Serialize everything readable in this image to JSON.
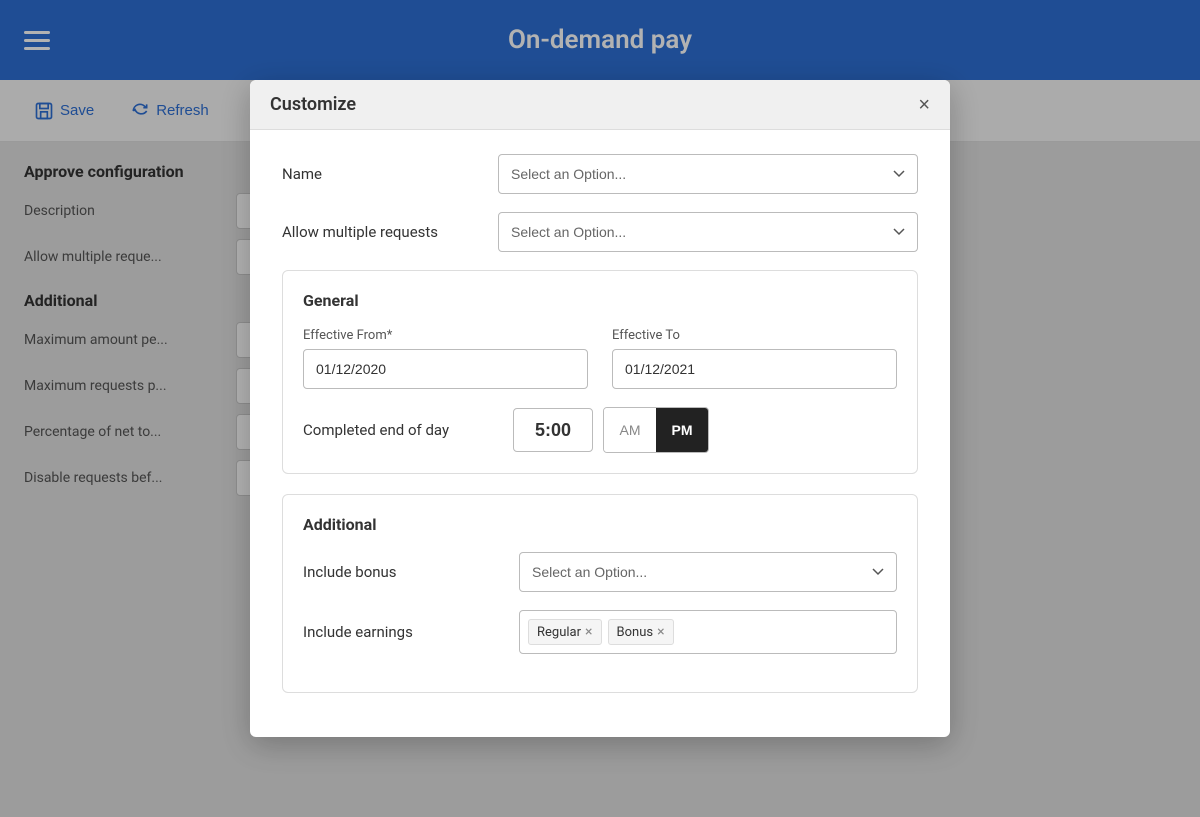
{
  "header": {
    "title": "On-demand pay",
    "menu_icon": "menu-icon"
  },
  "toolbar": {
    "save_label": "Save",
    "refresh_label": "Refresh"
  },
  "background": {
    "sections": [
      {
        "heading": "Approve configuration",
        "fields": [
          {
            "label": "Description"
          },
          {
            "label": "Allow multiple reque..."
          }
        ]
      },
      {
        "heading": "Additional",
        "fields": [
          {
            "label": "Maximum amount pe..."
          },
          {
            "label": "Maximum requests p..."
          },
          {
            "label": "Percentage of net to..."
          },
          {
            "label": "Disable requests bef..."
          }
        ]
      }
    ]
  },
  "modal": {
    "title": "Customize",
    "close_label": "×",
    "fields": {
      "name": {
        "label": "Name",
        "placeholder": "Select an Option..."
      },
      "allow_multiple_requests": {
        "label": "Allow multiple requests",
        "placeholder": "Select an Option..."
      }
    },
    "general_section": {
      "title": "General",
      "effective_from": {
        "label": "Effective From*",
        "value": "01/12/2020"
      },
      "effective_to": {
        "label": "Effective To",
        "value": "01/12/2021"
      },
      "completed_end_of_day": {
        "label": "Completed end of day",
        "time_value": "5:00",
        "am_label": "AM",
        "pm_label": "PM",
        "active": "PM"
      }
    },
    "additional_section": {
      "title": "Additional",
      "include_bonus": {
        "label": "Include bonus",
        "placeholder": "Select an Option..."
      },
      "include_earnings": {
        "label": "Include earnings",
        "tags": [
          {
            "label": "Regular"
          },
          {
            "label": "Bonus"
          }
        ]
      }
    }
  }
}
